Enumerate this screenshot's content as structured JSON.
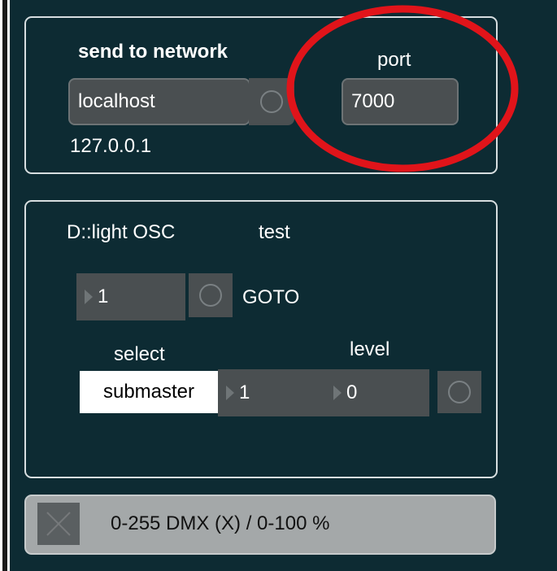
{
  "network": {
    "title": "send to network",
    "host_value": "localhost",
    "ip_value": "127.0.0.1",
    "port_label": "port",
    "port_value": "7000"
  },
  "osc": {
    "title": "D::light OSC",
    "test_label": "test",
    "goto_number": "1",
    "goto_label": "GOTO",
    "select_label": "select",
    "level_label": "level",
    "select_value": "submaster",
    "select_number": "1",
    "level_value": "0"
  },
  "bottom": {
    "toggle_icon": "x-icon",
    "text": "0-255 DMX (X) / 0-100 %"
  },
  "colors": {
    "background": "#0d2b33",
    "highlight": "#e0141a"
  }
}
